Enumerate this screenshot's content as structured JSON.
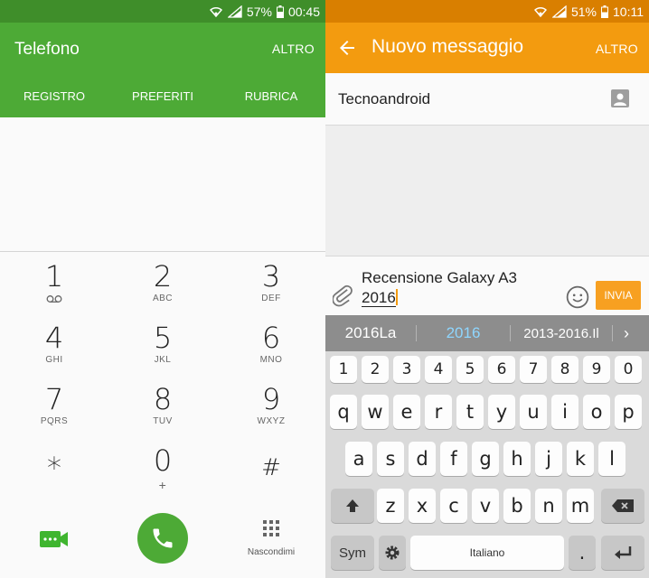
{
  "left": {
    "status": {
      "battery": "57%",
      "time": "00:45"
    },
    "title": "Telefono",
    "more": "ALTRO",
    "tabs": [
      "REGISTRO",
      "PREFERITI",
      "RUBRICA"
    ],
    "keys": [
      {
        "digit": "1",
        "letters": ""
      },
      {
        "digit": "2",
        "letters": "ABC"
      },
      {
        "digit": "3",
        "letters": "DEF"
      },
      {
        "digit": "4",
        "letters": "GHI"
      },
      {
        "digit": "5",
        "letters": "JKL"
      },
      {
        "digit": "6",
        "letters": "MNO"
      },
      {
        "digit": "7",
        "letters": "PQRS"
      },
      {
        "digit": "8",
        "letters": "TUV"
      },
      {
        "digit": "9",
        "letters": "WXYZ"
      },
      {
        "digit": "*",
        "letters": ""
      },
      {
        "digit": "0",
        "letters": "+"
      },
      {
        "digit": "#",
        "letters": ""
      }
    ],
    "hide_label": "Nascondimi",
    "colors": {
      "primary": "#4daa36",
      "statusbar": "#3f8e2a"
    }
  },
  "right": {
    "status": {
      "battery": "51%",
      "time": "10:11"
    },
    "title": "Nuovo messaggio",
    "more": "ALTRO",
    "recipient": "Tecnoandroid",
    "message_line1": "Recensione Galaxy A3",
    "message_line2": "2016",
    "send": "INVIA",
    "suggestions": [
      "2016La",
      "2016",
      "2013-2016.Il"
    ],
    "number_row": [
      "1",
      "2",
      "3",
      "4",
      "5",
      "6",
      "7",
      "8",
      "9",
      "0"
    ],
    "row1": [
      "q",
      "w",
      "e",
      "r",
      "t",
      "y",
      "u",
      "i",
      "o",
      "p"
    ],
    "row2": [
      "a",
      "s",
      "d",
      "f",
      "g",
      "h",
      "j",
      "k",
      "l"
    ],
    "row3": [
      "z",
      "x",
      "c",
      "v",
      "b",
      "n",
      "m"
    ],
    "sym_label": "Sym",
    "space_label": "Italiano",
    "period": ".",
    "colors": {
      "primary": "#f39b0f",
      "statusbar": "#d97f00",
      "suggestion_highlight": "#8ed6ff"
    }
  }
}
